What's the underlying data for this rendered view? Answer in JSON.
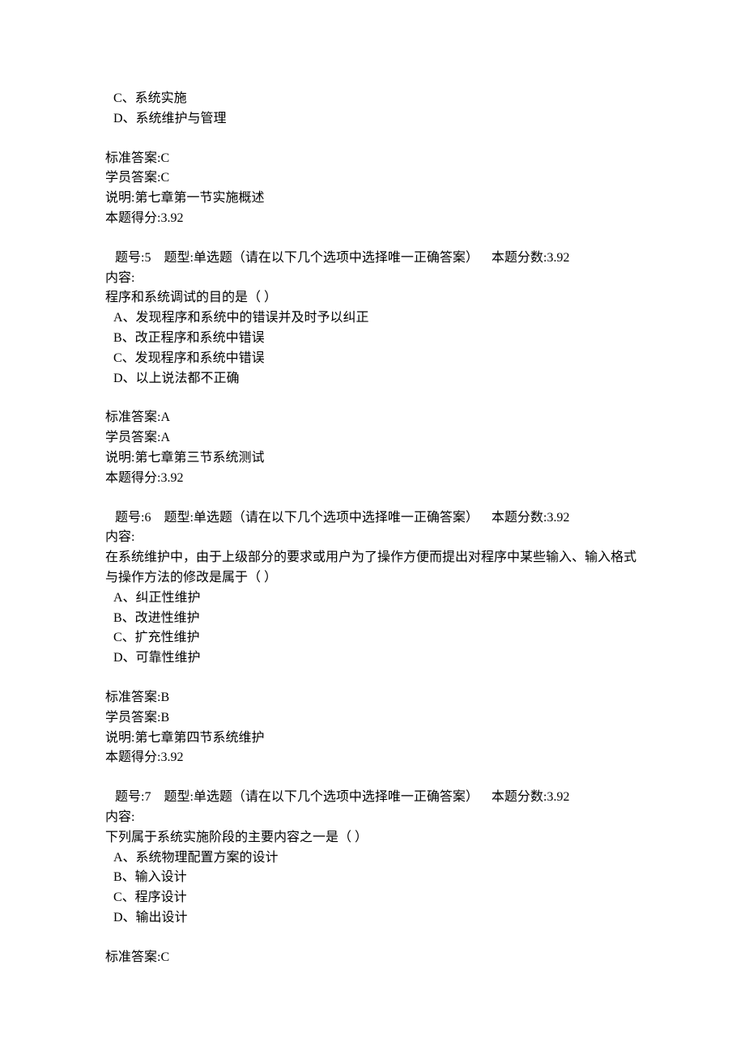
{
  "q4_partial": {
    "option_c": "C、系统实施",
    "option_d": "D、系统维护与管理",
    "std_answer": "标准答案:C",
    "stu_answer": "学员答案:C",
    "explain": "说明:第七章第一节实施概述",
    "score": "本题得分:3.92"
  },
  "q5": {
    "header": "   题号:5    题型:单选题（请在以下几个选项中选择唯一正确答案）    本题分数:3.92",
    "content_label": "内容:",
    "stem": "程序和系统调试的目的是（ ）",
    "option_a": "A、发现程序和系统中的错误并及时予以纠正",
    "option_b": "B、改正程序和系统中错误",
    "option_c": "C、发现程序和系统中错误",
    "option_d": "D、以上说法都不正确",
    "std_answer": "标准答案:A",
    "stu_answer": "学员答案:A",
    "explain": "说明:第七章第三节系统测试",
    "score": "本题得分:3.92"
  },
  "q6": {
    "header": "   题号:6    题型:单选题（请在以下几个选项中选择唯一正确答案）    本题分数:3.92",
    "content_label": "内容:",
    "stem": "在系统维护中，由于上级部分的要求或用户为了操作方便而提出对程序中某些输入、输入格式与操作方法的修改是属于（ ）",
    "option_a": "A、纠正性维护",
    "option_b": "B、改进性维护",
    "option_c": "C、扩充性维护",
    "option_d": "D、可靠性维护",
    "std_answer": "标准答案:B",
    "stu_answer": "学员答案:B",
    "explain": "说明:第七章第四节系统维护",
    "score": "本题得分:3.92"
  },
  "q7": {
    "header": "   题号:7    题型:单选题（请在以下几个选项中选择唯一正确答案）    本题分数:3.92",
    "content_label": "内容:",
    "stem": "下列属于系统实施阶段的主要内容之一是（ ）",
    "option_a": "A、系统物理配置方案的设计",
    "option_b": "B、输入设计",
    "option_c": "C、程序设计",
    "option_d": "D、输出设计",
    "std_answer": "标准答案:C"
  }
}
